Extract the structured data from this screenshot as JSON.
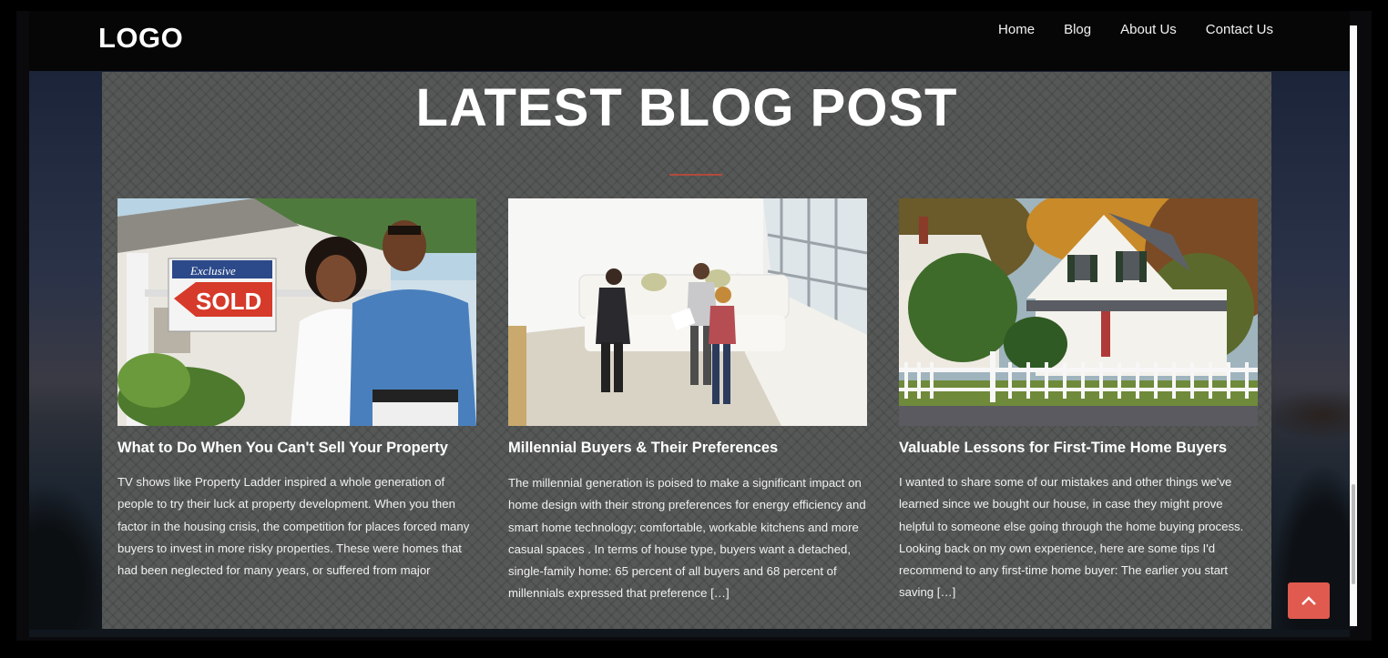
{
  "header": {
    "logo": "LOGO",
    "nav": [
      "Home",
      "Blog",
      "About Us",
      "Contact Us"
    ]
  },
  "section": {
    "title": "LATEST BLOG POST"
  },
  "posts": [
    {
      "title": "What to Do When You Can't Sell Your Property",
      "excerpt": "TV shows like Property Ladder inspired a whole generation of people to try their luck at property development. When you then factor in the housing crisis, the competition for places forced many buyers to invest in more risky properties. These were homes that had been neglected for many years, or suffered from major",
      "image": "couple-sold-sign",
      "sign_text": "SOLD",
      "sign_top": "Exclusive"
    },
    {
      "title": "Millennial Buyers & Their Preferences",
      "excerpt": "The millennial generation is poised to make a significant impact on home design with their strong preferences for energy efficiency and smart home technology; comfortable, workable kitchens and more casual spaces . In terms of house type, buyers want a detached, single-family home: 65 percent of all buyers and 68 percent of millennials expressed that preference […]",
      "image": "agent-handshake-living-room"
    },
    {
      "title": "Valuable Lessons for First-Time Home Buyers",
      "excerpt": "I wanted to share some of our mistakes and other things we've learned since we bought our house, in case they might prove helpful to someone else going through the home buying process. Looking back on my own experience, here are some tips I'd recommend to any first-time home buyer: The earlier you start saving […]",
      "image": "white-house-picket-fence"
    }
  ],
  "back_to_top": {
    "icon": "chevron-up-icon"
  },
  "colors": {
    "accent": "#e05a4f",
    "panel": "#555856",
    "divider": "#b34a3e"
  }
}
